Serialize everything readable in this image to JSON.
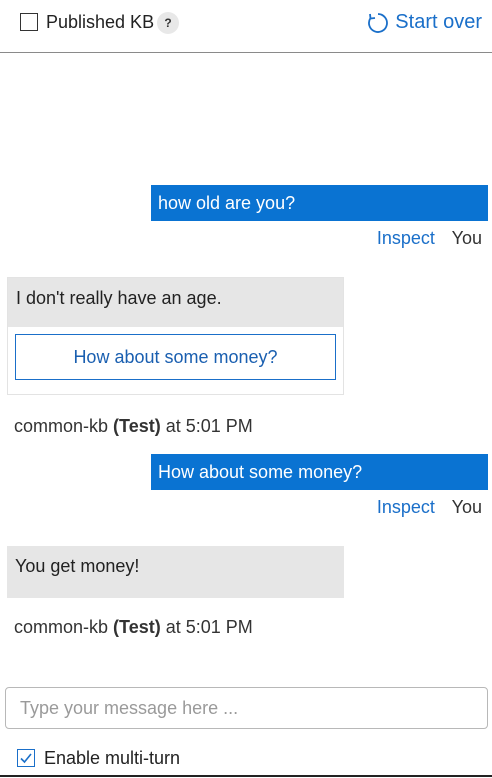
{
  "header": {
    "published_label": "Published KB",
    "help_label": "?",
    "start_over_label": "Start over"
  },
  "conversation": [
    {
      "role": "user",
      "text": "how old are you?",
      "inspect_label": "Inspect",
      "sender": "You"
    },
    {
      "role": "bot",
      "text": "I don't really have an age.",
      "suggestion": "How about some money?",
      "kb_name": "common-kb",
      "env": "(Test)",
      "time": "at 5:01 PM"
    },
    {
      "role": "user",
      "text": "How about some money?",
      "inspect_label": "Inspect",
      "sender": "You"
    },
    {
      "role": "bot",
      "text": "You get money!",
      "kb_name": "common-kb",
      "env": "(Test)",
      "time": "at 5:01 PM"
    }
  ],
  "composer": {
    "placeholder": "Type your message here ...",
    "enable_multiturn_label": "Enable multi-turn",
    "multiturn_checked": true
  },
  "colors": {
    "accent": "#1a6fc9",
    "user_bubble": "#0a73d2",
    "bot_bubble": "#e6e6e6"
  }
}
